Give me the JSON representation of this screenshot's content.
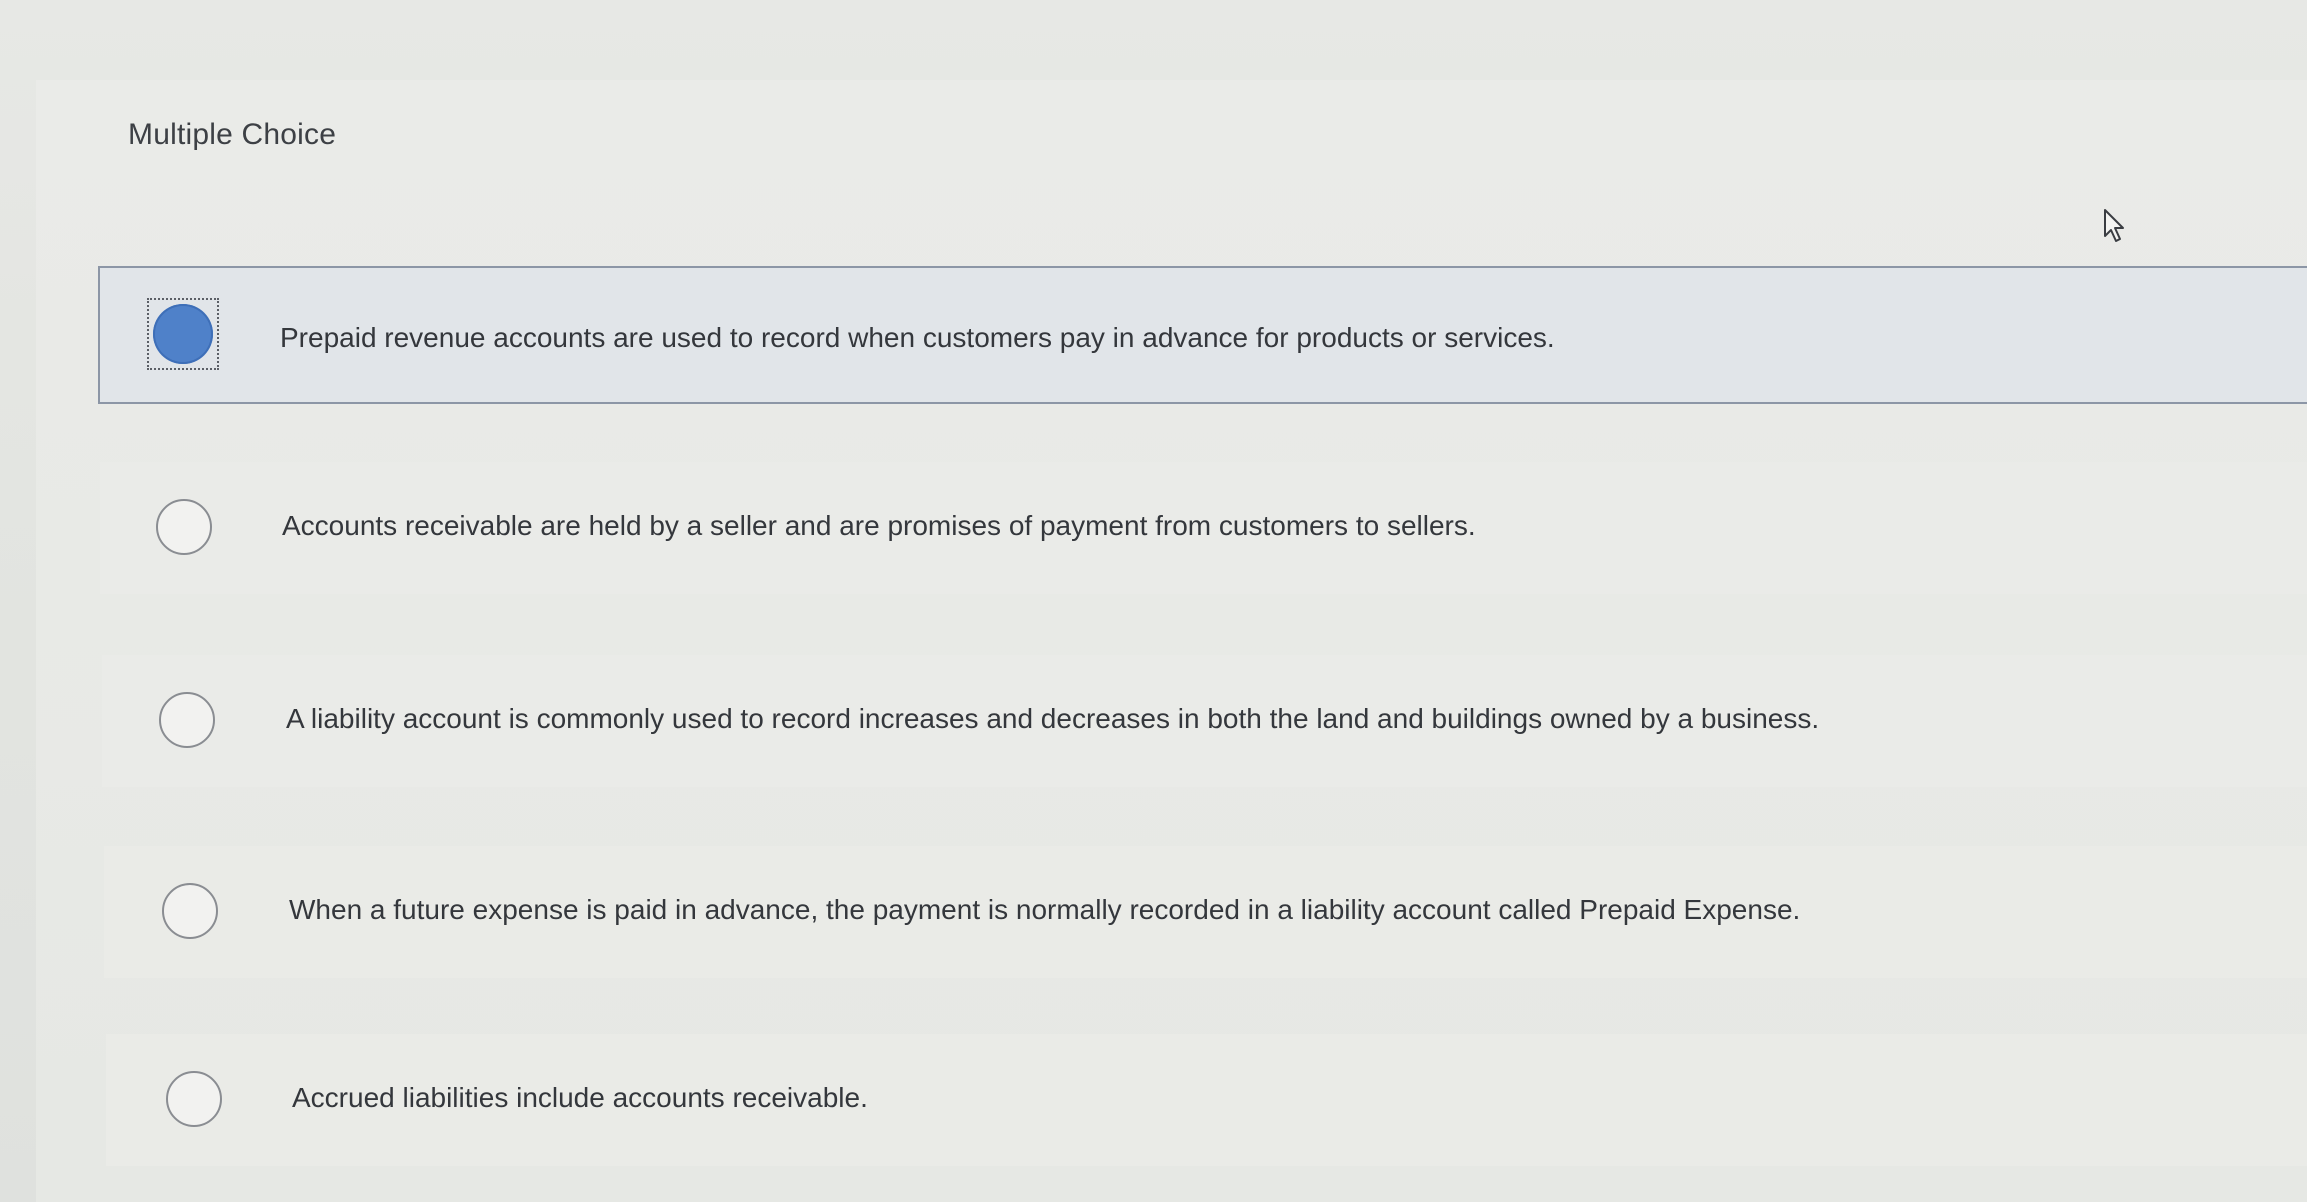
{
  "question": {
    "heading": "Multiple Choice"
  },
  "options": [
    {
      "label": "Prepaid revenue accounts are used to record when customers pay in advance for products or services.",
      "selected": true
    },
    {
      "label": "Accounts receivable are held by a seller and are promises of payment from customers to sellers.",
      "selected": false
    },
    {
      "label": "A liability account is commonly used to record increases and decreases in both the land and buildings owned by a business.",
      "selected": false
    },
    {
      "label": "When a future expense is paid in advance, the payment is normally recorded in a liability account called Prepaid Expense.",
      "selected": false
    },
    {
      "label": "Accrued liabilities include accounts receivable.",
      "selected": false
    }
  ],
  "colors": {
    "selected_radio": "#4f81c9",
    "selected_row_border": "#8c96a6"
  },
  "icons": {
    "cursor": "mouse-pointer-icon"
  }
}
